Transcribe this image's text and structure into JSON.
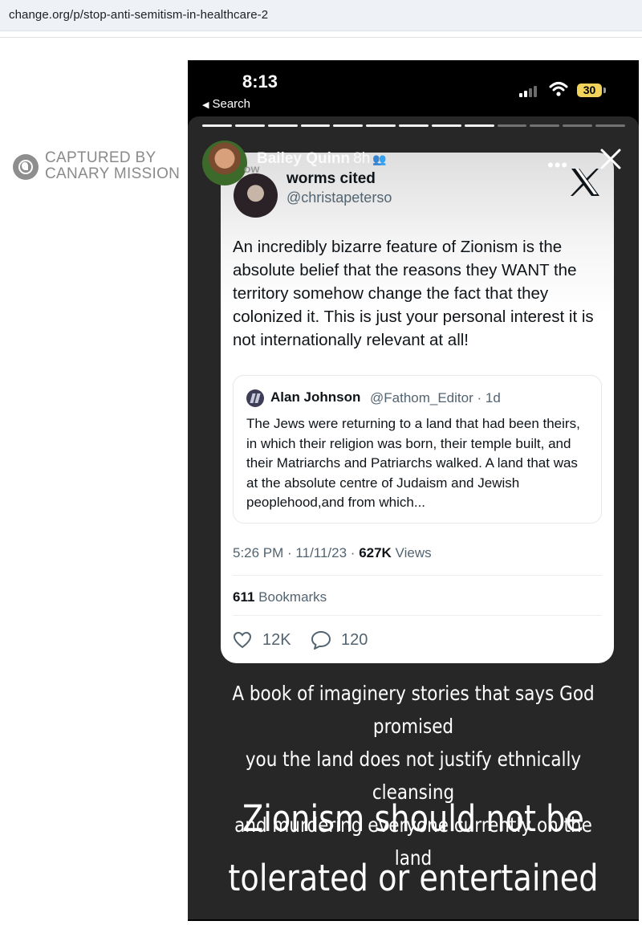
{
  "browser": {
    "url": "change.org/p/stop-anti-semitism-in-healthcare-2"
  },
  "watermark": {
    "line1": "CAPTURED BY",
    "line2": "CANARY MISSION"
  },
  "phone": {
    "status_time": "8:13",
    "back_label": "Search",
    "battery": "30",
    "icons": [
      "signal-icon",
      "wifi-icon",
      "battery-icon"
    ]
  },
  "story": {
    "progress_segments": 13,
    "progress_done": 9,
    "follow_label": "ow",
    "username": "Bailey Quinn",
    "time_ago": "8h",
    "more_label": "•••",
    "caption1": [
      "A book of imaginery stories that says God promised",
      "you the land does not justify ethnically cleansing",
      "and murdering everyone currently on the land"
    ],
    "caption2": [
      "Zionism should not be",
      "tolerated or entertained"
    ]
  },
  "tweet": {
    "name": "worms cited",
    "handle": "@christapeterso",
    "text": "An incredibly bizarre feature of Zionism is the absolute belief that the reasons they WANT the territory somehow change the fact that they colonized it. This is just your personal interest it is not internationally relevant at all!",
    "quote": {
      "name": "Alan Johnson",
      "meta": "@Fathom_Editor · 1d",
      "text": "The Jews were returning to a land that had been theirs, in which their religion was born, their temple built, and their Matriarchs and Patriarchs walked. A land that was at the absolute centre of Judaism and Jewish peoplehood,and from which..."
    },
    "date": "5:26 PM · 11/11/23 · ",
    "views_count": "627K",
    "views_label": " Views",
    "bookmarks_count": "611",
    "bookmarks_label": " Bookmarks",
    "likes": "12K",
    "replies": "120"
  }
}
